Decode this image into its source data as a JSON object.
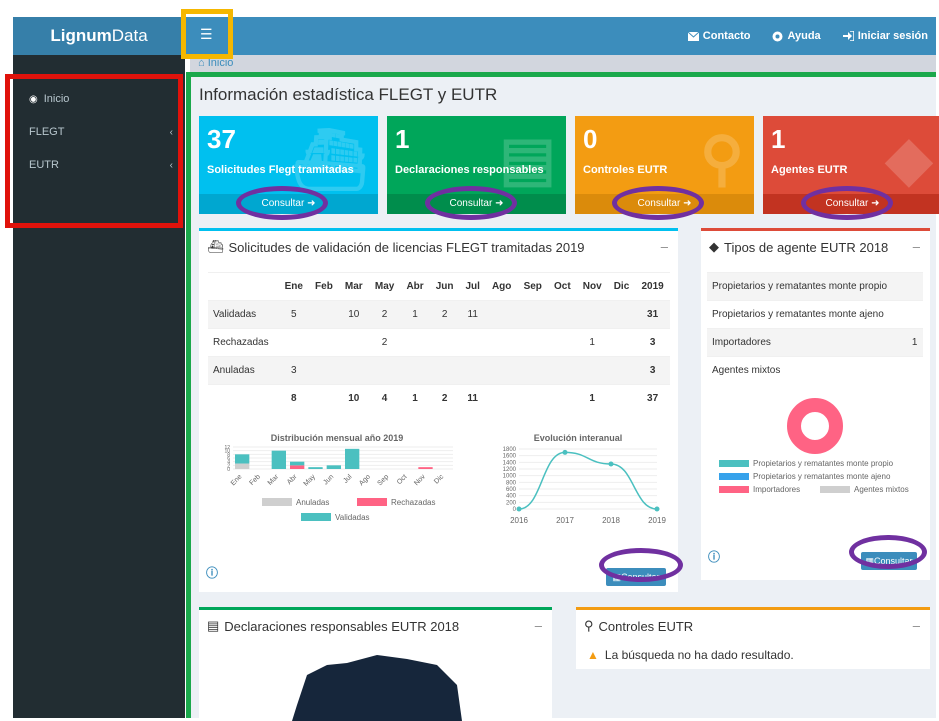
{
  "app": {
    "logo_bold": "Lignum",
    "logo_rest": "Data",
    "menu_icon": "hamburger-icon"
  },
  "nav": {
    "contact": "Contacto",
    "help": "Ayuda",
    "login": "Iniciar sesión"
  },
  "sidebar": {
    "items": [
      {
        "label": "Inicio",
        "icon": "dashboard-icon"
      },
      {
        "label": "FLEGT"
      },
      {
        "label": "EUTR"
      }
    ]
  },
  "breadcrumb": {
    "home": "Inicio"
  },
  "page": {
    "title": "Información estadística FLEGT y EUTR"
  },
  "stats": [
    {
      "num": "37",
      "label": "Solicitudes Flegt tramitadas",
      "action": "Consultar",
      "color": "#00c0ef",
      "icon": "ship-icon"
    },
    {
      "num": "1",
      "label": "Declaraciones responsables",
      "action": "Consultar",
      "color": "#00a65a",
      "icon": "document-icon"
    },
    {
      "num": "0",
      "label": "Controles EUTR",
      "action": "Consultar",
      "color": "#f39c12",
      "icon": "search-icon"
    },
    {
      "num": "1",
      "label": "Agentes EUTR",
      "action": "Consultar",
      "color": "#dd4b39",
      "icon": "tag-icon"
    }
  ],
  "flegt": {
    "title": "Solicitudes de validación de licencias FLEGT tramitadas 2019",
    "headers": [
      "",
      "Ene",
      "Feb",
      "Mar",
      "May",
      "Abr",
      "Jun",
      "Jul",
      "Ago",
      "Sep",
      "Oct",
      "Nov",
      "Dic",
      "2019"
    ],
    "rows": [
      [
        "Validadas",
        "5",
        "",
        "10",
        "2",
        "1",
        "2",
        "11",
        "",
        "",
        "",
        "",
        "",
        "31"
      ],
      [
        "Rechazadas",
        "",
        "",
        "",
        "2",
        "",
        "",
        "",
        "",
        "",
        "",
        "1",
        "",
        "3"
      ],
      [
        "Anuladas",
        "3",
        "",
        "",
        "",
        "",
        "",
        "",
        "",
        "",
        "",
        "",
        "",
        "3"
      ],
      [
        "",
        "8",
        "",
        "10",
        "4",
        "1",
        "2",
        "11",
        "",
        "",
        "",
        "1",
        "",
        "37"
      ]
    ],
    "consult": "Consultar"
  },
  "chart_data": [
    {
      "type": "bar",
      "title": "Distribución mensual año 2019",
      "categories": [
        "Ene",
        "Feb",
        "Mar",
        "Abr",
        "May",
        "Jun",
        "Jul",
        "Ago",
        "Sep",
        "Oct",
        "Nov",
        "Dic"
      ],
      "series": [
        {
          "name": "Anuladas",
          "values": [
            3,
            0,
            0,
            0,
            0,
            0,
            0,
            0,
            0,
            0,
            0,
            0
          ]
        },
        {
          "name": "Rechazadas",
          "values": [
            0,
            0,
            0,
            2,
            0,
            0,
            0,
            0,
            0,
            0,
            1,
            0
          ]
        },
        {
          "name": "Validadas",
          "values": [
            5,
            0,
            10,
            2,
            1,
            2,
            11,
            0,
            0,
            0,
            0,
            0
          ]
        }
      ],
      "ylim": [
        0,
        12
      ],
      "ytick_labels": [
        "0",
        "2",
        "4",
        "6",
        "8",
        "10",
        "12"
      ],
      "legend": "bottom",
      "colors": [
        "#cfcfcf",
        "#ff6384",
        "#4bc0c0"
      ]
    },
    {
      "type": "line",
      "title": "Evolución interanual",
      "x": [
        "2016",
        "2017",
        "2018",
        "2019"
      ],
      "series": [
        {
          "values": [
            0,
            1700,
            1350,
            0
          ]
        }
      ],
      "ylim": [
        0,
        1800
      ],
      "ytick_labels": [
        "0",
        "200",
        "400",
        "600",
        "800",
        "1000",
        "1200",
        "1400",
        "1600",
        "1800"
      ],
      "color": "#4bc0c0"
    },
    {
      "type": "pie",
      "labels": [
        "Propietarios y rematantes monte propio",
        "Propietarios y rematantes monte ajeno",
        "Importadores",
        "Agentes mixtos"
      ],
      "values": [
        0,
        0,
        1,
        0
      ],
      "colors": [
        "#4bc0c0",
        "#36a2eb",
        "#ff6384",
        "#cfcfcf"
      ],
      "legend": "bottom"
    }
  ],
  "agents": {
    "title": "Tipos de agente EUTR 2018",
    "rows": [
      [
        "Propietarios y rematantes monte propio",
        ""
      ],
      [
        "Propietarios y rematantes monte ajeno",
        ""
      ],
      [
        "Importadores",
        "1"
      ],
      [
        "Agentes mixtos",
        ""
      ]
    ],
    "consult": "Consultar"
  },
  "decl": {
    "title": "Declaraciones responsables EUTR 2018"
  },
  "controls": {
    "title": "Controles EUTR",
    "warn": "La búsqueda no ha dado resultado."
  }
}
